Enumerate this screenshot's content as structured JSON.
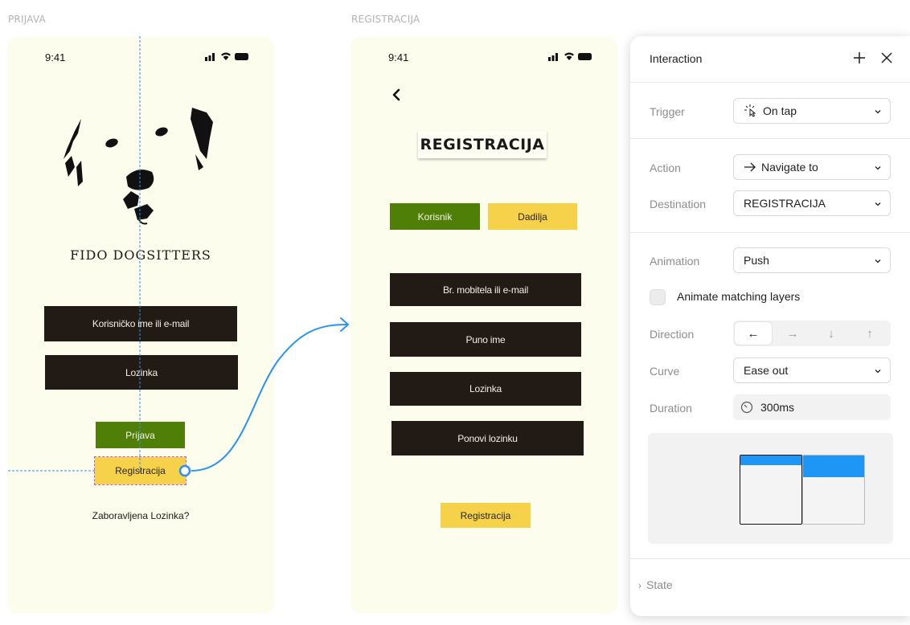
{
  "frames": {
    "login_label": "PRIJAVA",
    "register_label": "REGISTRACIJA"
  },
  "login": {
    "time": "9:41",
    "brand": "FIDO DOGSITTERS",
    "username_field": "Korisničko ime ili e-mail",
    "password_field": "Lozinka",
    "login_button": "Prijava",
    "register_button": "Registracija",
    "forgot_link": "Zaboravljena Lozinka?"
  },
  "register": {
    "time": "9:41",
    "title": "REGISTRACIJA",
    "tab_user": "Korisnik",
    "tab_sitter": "Dadilja",
    "phone_email_field": "Br. mobitela ili e-mail",
    "fullname_field": "Puno ime",
    "password_field": "Lozinka",
    "repeat_password_field": "Ponovi lozinku",
    "register_button": "Registracija"
  },
  "interaction": {
    "title": "Interaction",
    "trigger_label": "Trigger",
    "trigger_value": "On tap",
    "action_label": "Action",
    "action_value": "Navigate to",
    "destination_label": "Destination",
    "destination_value": "REGISTRACIJA",
    "animation_label": "Animation",
    "animation_value": "Push",
    "animate_matching_label": "Animate matching layers",
    "animate_matching_checked": false,
    "direction_label": "Direction",
    "direction_options": [
      "←",
      "→",
      "↓",
      "↑"
    ],
    "direction_selected": "←",
    "curve_label": "Curve",
    "curve_value": "Ease out",
    "duration_label": "Duration",
    "duration_value": "300ms",
    "state_label": "State"
  },
  "colors": {
    "phone_bg": "#fdfdee",
    "dark_field": "#221a14",
    "green_button": "#4f7f07",
    "yellow_button": "#f5d24a",
    "connector": "#2a93f1",
    "preview_header": "#1e96f5"
  }
}
